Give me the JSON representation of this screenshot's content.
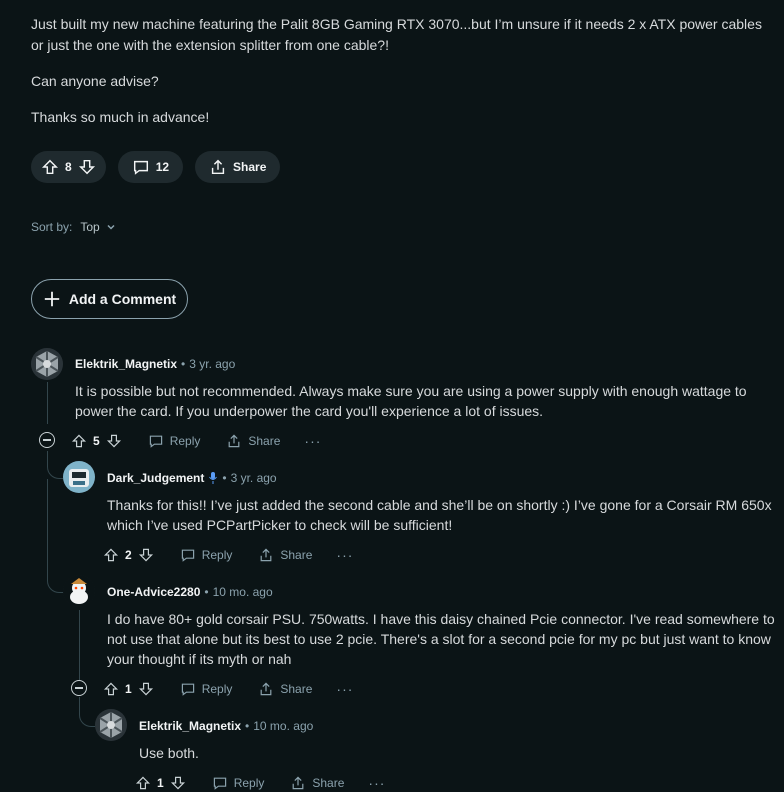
{
  "post": {
    "paragraphs": [
      "Just built my new machine featuring the Palit 8GB Gaming RTX 3070...but I’m unsure if it needs 2 x ATX power cables or just the one with the extension splitter from one cable?!",
      "Can anyone advise?",
      "Thanks so much in advance!"
    ],
    "upvotes": "8",
    "comments": "12",
    "share_label": "Share"
  },
  "sort": {
    "label": "Sort by:",
    "value": "Top"
  },
  "add_comment_label": "Add a Comment",
  "comments": [
    {
      "user": "Elektrik_Magnetix",
      "time": "3 yr. ago",
      "text": "It is possible but not recommended. Always make sure you are using a power supply with enough wattage to power the card. If you underpower the card you'll experience a lot of issues.",
      "votes": "5",
      "reply": "Reply",
      "share": "Share"
    },
    {
      "user": "Dark_Judgement",
      "time": "3 yr. ago",
      "text": "Thanks for this!! I’ve just added the second cable and she’ll be on shortly :) I’ve gone for a Corsair RM 650x which I’ve used PCPartPicker to check will be sufficient!",
      "votes": "2",
      "reply": "Reply",
      "share": "Share"
    },
    {
      "user": "One-Advice2280",
      "time": "10 mo. ago",
      "text": "I do have 80+ gold corsair PSU. 750watts. I have this daisy chained Pcie connector. I've read somewhere to not use that alone but its best to use 2 pcie. There's a slot for a second pcie for my pc but just want to know your thought if its myth or nah",
      "votes": "1",
      "reply": "Reply",
      "share": "Share"
    },
    {
      "user": "Elektrik_Magnetix",
      "time": "10 mo. ago",
      "text": "Use both.",
      "votes": "1",
      "reply": "Reply",
      "share": "Share"
    }
  ],
  "separator": "•",
  "more": "···"
}
